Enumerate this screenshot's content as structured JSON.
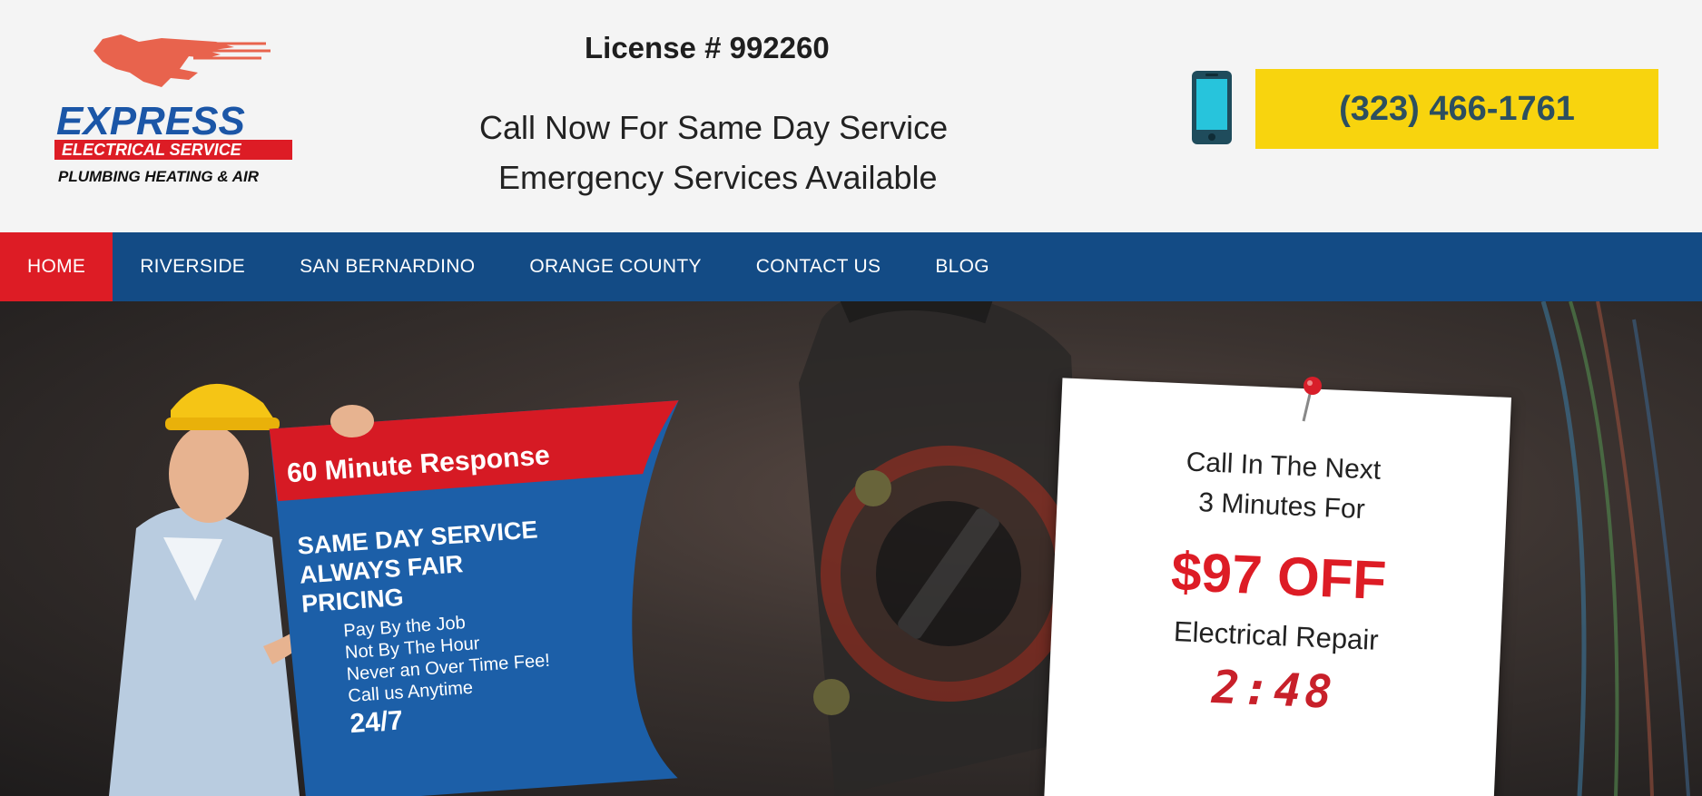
{
  "header": {
    "logo": {
      "line1": "EXPRESS",
      "line2": "ELECTRICAL SERVICE",
      "line3": "PLUMBING HEATING & AIR"
    },
    "license": "License # 992260",
    "tagline1": "Call Now For Same Day Service",
    "tagline2": "Emergency Services Available",
    "phone": "(323) 466-1761",
    "phone_icon": "mobile-phone-icon"
  },
  "nav": {
    "items": [
      {
        "label": "HOME",
        "active": true
      },
      {
        "label": "RIVERSIDE",
        "active": false
      },
      {
        "label": "SAN BERNARDINO",
        "active": false
      },
      {
        "label": "ORANGE COUNTY",
        "active": false
      },
      {
        "label": "CONTACT US",
        "active": false
      },
      {
        "label": "BLOG",
        "active": false
      }
    ]
  },
  "hero": {
    "sign": {
      "headline": "60 Minute Response",
      "line1": "SAME DAY SERVICE",
      "line2": "ALWAYS FAIR",
      "line3": "PRICING",
      "line4": "Pay By the Job",
      "line5": "Not By The Hour",
      "line6": "Never an Over Time Fee!",
      "line7": "Call us Anytime",
      "line8": "24/7"
    },
    "coupon": {
      "line1": "Call In The Next",
      "line2": "3 Minutes For",
      "offer": "$97 OFF",
      "service": "Electrical Repair",
      "timer": "2:48"
    }
  },
  "colors": {
    "nav_bg": "#134b85",
    "active_nav": "#dd1c25",
    "phone_btn": "#f8d40e",
    "offer_red": "#dd1c25"
  }
}
